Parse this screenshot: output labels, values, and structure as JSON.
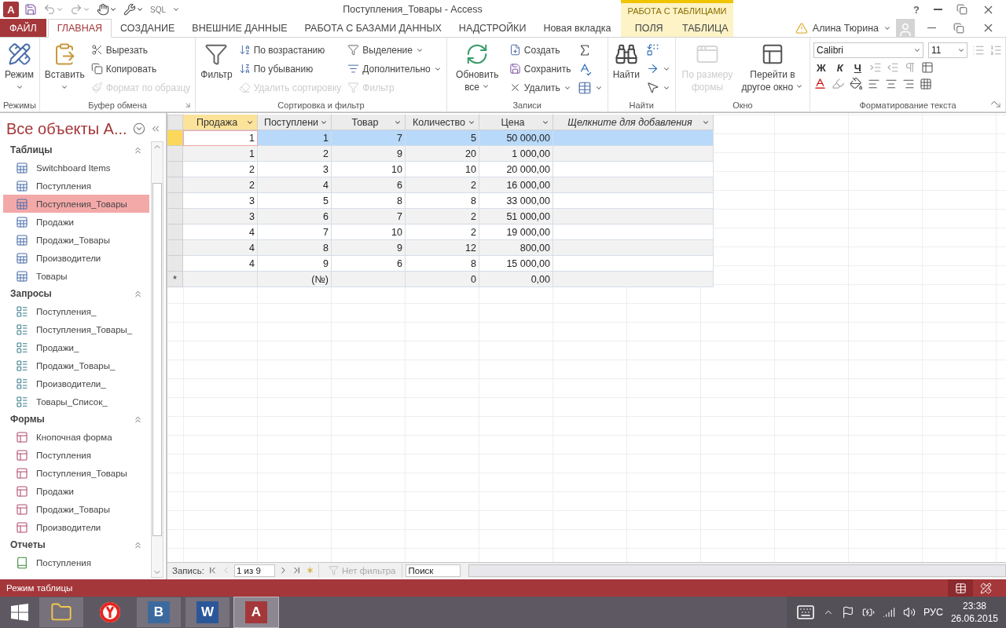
{
  "title_bar": {
    "app_logo": "A",
    "sql_label": "SQL",
    "title": "Поступления_Товары - Access",
    "context_group": "РАБОТА С ТАБЛИЦАМИ",
    "help": "?"
  },
  "tabs": [
    {
      "label": "ФАЙЛ",
      "kind": "file",
      "selected": false
    },
    {
      "label": "ГЛАВНАЯ",
      "kind": "normal",
      "selected": true
    },
    {
      "label": "СОЗДАНИЕ",
      "kind": "normal",
      "selected": false
    },
    {
      "label": "ВНЕШНИЕ ДАННЫЕ",
      "kind": "normal",
      "selected": false
    },
    {
      "label": "РАБОТА С БАЗАМИ ДАННЫХ",
      "kind": "normal",
      "selected": false
    },
    {
      "label": "НАДСТРОЙКИ",
      "kind": "normal",
      "selected": false
    },
    {
      "label": "Новая вкладка",
      "kind": "normal",
      "selected": false
    },
    {
      "label": "ПОЛЯ",
      "kind": "context",
      "selected": false
    },
    {
      "label": "ТАБЛИЦА",
      "kind": "context",
      "selected": false
    }
  ],
  "account": {
    "user": "Алина Тюрина"
  },
  "ribbon": {
    "groups": [
      {
        "label": "Режимы",
        "launcher": false,
        "columns": [
          {
            "kind": "large",
            "items": [
              {
                "label": "Режим",
                "dropdown": true,
                "disabled": false
              }
            ]
          }
        ]
      },
      {
        "label": "Буфер обмена",
        "launcher": true,
        "columns": [
          {
            "kind": "large",
            "items": [
              {
                "label": "Вставить",
                "dropdown": true,
                "disabled": false
              }
            ]
          },
          {
            "kind": "small",
            "items": [
              {
                "label": "Вырезать",
                "dropdown": false,
                "disabled": false
              },
              {
                "label": "Копировать",
                "dropdown": false,
                "disabled": false
              },
              {
                "label": "Формат по образцу",
                "dropdown": false,
                "disabled": true
              }
            ]
          }
        ]
      },
      {
        "label": "Сортировка и фильтр",
        "launcher": false,
        "columns": [
          {
            "kind": "large",
            "items": [
              {
                "label": "Фильтр",
                "dropdown": false,
                "disabled": false
              }
            ]
          },
          {
            "kind": "small",
            "items": [
              {
                "label": "По возрастанию",
                "dropdown": false,
                "disabled": false
              },
              {
                "label": "По убыванию",
                "dropdown": false,
                "disabled": false
              },
              {
                "label": "Удалить сортировку",
                "dropdown": false,
                "disabled": true
              }
            ]
          },
          {
            "kind": "small",
            "items": [
              {
                "label": "Выделение",
                "dropdown": true,
                "disabled": false
              },
              {
                "label": "Дополнительно",
                "dropdown": true,
                "disabled": false
              },
              {
                "label": "Фильтр",
                "dropdown": false,
                "disabled": true
              }
            ]
          }
        ]
      },
      {
        "label": "Записи",
        "launcher": false,
        "columns": [
          {
            "kind": "large_wrap",
            "items": [
              {
                "label": "Обновить все",
                "dropdown": true,
                "disabled": false
              }
            ]
          },
          {
            "kind": "small",
            "items": [
              {
                "label": "Создать",
                "dropdown": false,
                "disabled": false
              },
              {
                "label": "Сохранить",
                "dropdown": false,
                "disabled": false
              },
              {
                "label": "Удалить",
                "dropdown": true,
                "disabled": false
              }
            ]
          },
          {
            "kind": "icons",
            "items": [
              {
                "dropdown": false
              },
              {
                "dropdown": false
              },
              {
                "dropdown": true
              }
            ]
          }
        ]
      },
      {
        "label": "Найти",
        "launcher": false,
        "columns": [
          {
            "kind": "large",
            "items": [
              {
                "label": "Найти",
                "dropdown": false,
                "disabled": false
              }
            ]
          },
          {
            "kind": "icons",
            "items": [
              {
                "dropdown": false
              },
              {
                "dropdown": true
              },
              {
                "dropdown": true
              }
            ]
          }
        ]
      },
      {
        "label": "Окно",
        "launcher": false,
        "columns": [
          {
            "kind": "large_wrap",
            "items": [
              {
                "label": "По размеру формы",
                "dropdown": false,
                "disabled": true
              }
            ]
          },
          {
            "kind": "large_wrap",
            "items": [
              {
                "label": "Перейти в другое окно",
                "dropdown": true,
                "disabled": false
              }
            ]
          }
        ]
      },
      {
        "label": "Форматирование текста",
        "launcher": true,
        "columns": [
          {
            "kind": "format",
            "font": "Calibri",
            "size": "11",
            "styles": [
              "Ж",
              "К",
              "Ч"
            ]
          }
        ]
      }
    ]
  },
  "navigation": {
    "title": "Все объекты A...",
    "groups": [
      {
        "label": "Таблицы",
        "kind": "table",
        "items": [
          {
            "label": "Switchboard Items",
            "selected": false
          },
          {
            "label": "Поступления",
            "selected": false
          },
          {
            "label": "Поступления_Товары",
            "selected": true
          },
          {
            "label": "Продажи",
            "selected": false
          },
          {
            "label": "Продажи_Товары",
            "selected": false
          },
          {
            "label": "Производители",
            "selected": false
          },
          {
            "label": "Товары",
            "selected": false
          }
        ]
      },
      {
        "label": "Запросы",
        "kind": "query",
        "items": [
          {
            "label": "Поступления_",
            "selected": false
          },
          {
            "label": "Поступления_Товары_",
            "selected": false
          },
          {
            "label": "Продажи_",
            "selected": false
          },
          {
            "label": "Продажи_Товары_",
            "selected": false
          },
          {
            "label": "Производители_",
            "selected": false
          },
          {
            "label": "Товары_Список_",
            "selected": false
          }
        ]
      },
      {
        "label": "Формы",
        "kind": "form",
        "items": [
          {
            "label": "Кнопочная форма",
            "selected": false
          },
          {
            "label": "Поступления",
            "selected": false
          },
          {
            "label": "Поступления_Товары",
            "selected": false
          },
          {
            "label": "Продажи",
            "selected": false
          },
          {
            "label": "Продажи_Товары",
            "selected": false
          },
          {
            "label": "Производители",
            "selected": false
          }
        ]
      },
      {
        "label": "Отчеты",
        "kind": "report",
        "items": [
          {
            "label": "Поступления",
            "selected": false
          }
        ]
      }
    ]
  },
  "datasheet": {
    "columns": [
      {
        "label": "Продажа",
        "kind": "field",
        "selected": true
      },
      {
        "label": "Поступлени",
        "kind": "field",
        "selected": false
      },
      {
        "label": "Товар",
        "kind": "field",
        "selected": false
      },
      {
        "label": "Количество",
        "kind": "field",
        "selected": false
      },
      {
        "label": "Цена",
        "kind": "field",
        "selected": false
      },
      {
        "label": "Щелкните для добавления",
        "kind": "add",
        "selected": false
      }
    ],
    "rows": [
      {
        "selected": true,
        "cells": [
          "1",
          "1",
          "7",
          "5",
          "50 000,00"
        ]
      },
      {
        "selected": false,
        "cells": [
          "1",
          "2",
          "9",
          "20",
          "1 000,00"
        ]
      },
      {
        "selected": false,
        "cells": [
          "2",
          "3",
          "10",
          "10",
          "20 000,00"
        ]
      },
      {
        "selected": false,
        "cells": [
          "2",
          "4",
          "6",
          "2",
          "16 000,00"
        ]
      },
      {
        "selected": false,
        "cells": [
          "3",
          "5",
          "8",
          "8",
          "33 000,00"
        ]
      },
      {
        "selected": false,
        "cells": [
          "3",
          "6",
          "7",
          "2",
          "51 000,00"
        ]
      },
      {
        "selected": false,
        "cells": [
          "4",
          "7",
          "10",
          "2",
          "19 000,00"
        ]
      },
      {
        "selected": false,
        "cells": [
          "4",
          "8",
          "9",
          "12",
          "800,00"
        ]
      },
      {
        "selected": false,
        "cells": [
          "4",
          "9",
          "6",
          "8",
          "15 000,00"
        ]
      }
    ],
    "new_row": {
      "marker": "*",
      "cells": [
        "",
        "(№)",
        "",
        "0",
        "0,00"
      ]
    }
  },
  "record_navigator": {
    "label": "Запись:",
    "position": "1 из 9",
    "filter": "Нет фильтра",
    "search_placeholder": "Поиск"
  },
  "status_bar": {
    "text": "Режим таблицы",
    "views": [
      {
        "selected": true
      },
      {
        "selected": false
      }
    ]
  },
  "taskbar": {
    "apps": [
      {
        "kind": "folder",
        "running": true,
        "selected": false
      },
      {
        "kind": "ring",
        "running": false,
        "selected": false
      },
      {
        "kind": "letter",
        "glyph": "B",
        "color": "#3d6a9e",
        "running": true,
        "selected": false
      },
      {
        "kind": "letter",
        "glyph": "W",
        "color": "#2b579a",
        "running": true,
        "selected": false
      },
      {
        "kind": "letter",
        "glyph": "A",
        "color": "#a4373a",
        "running": true,
        "selected": true
      }
    ],
    "language": "РУС",
    "time": "23:38",
    "date": "26.06.2015"
  }
}
